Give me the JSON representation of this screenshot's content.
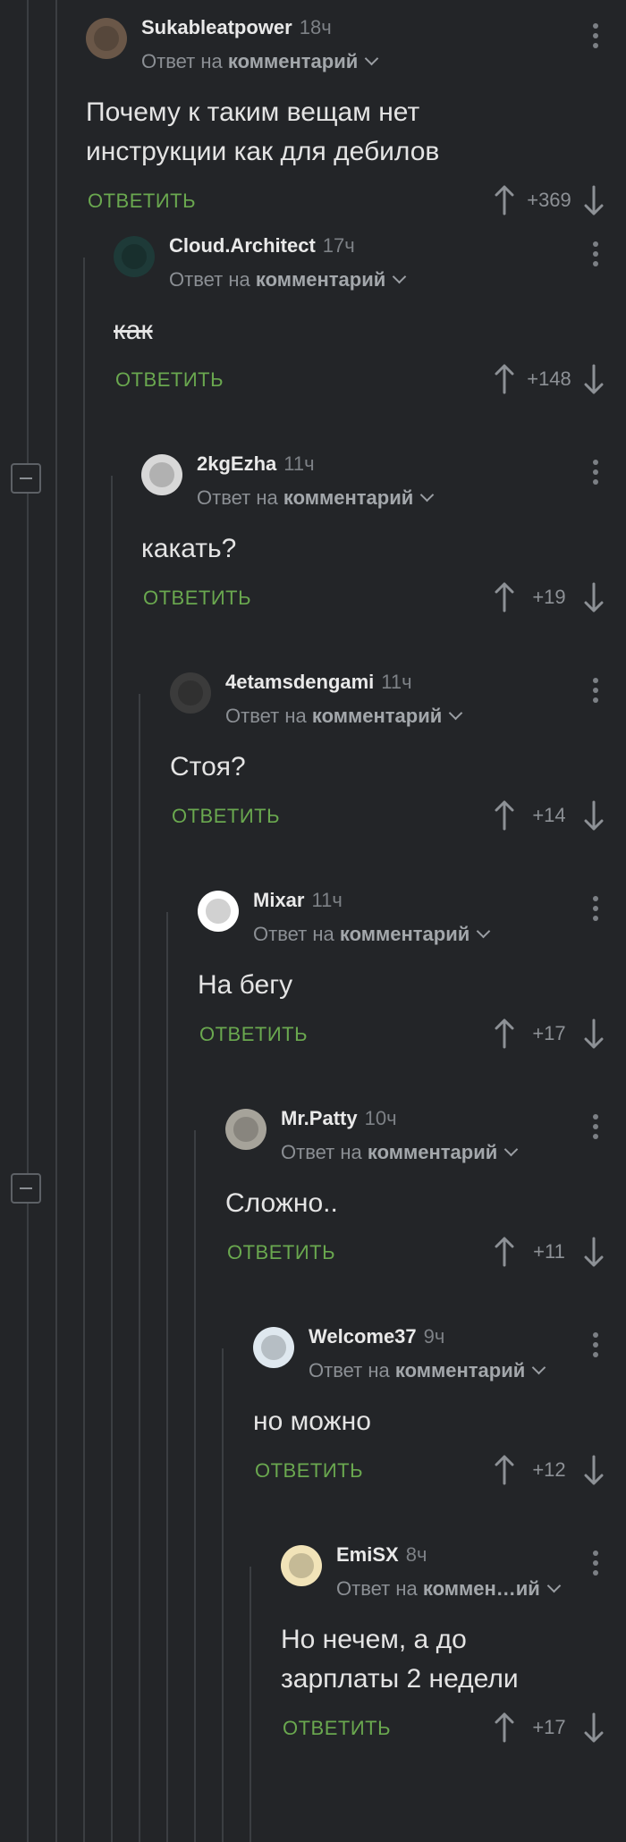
{
  "comments": [
    {
      "user": "Sukableatpower",
      "time": "18ч",
      "reply_prefix": "Ответ на",
      "reply_target": "комментарий",
      "text_lines": [
        "Почему к таким вещам нет",
        "инструкции как для дебилов"
      ],
      "reply_label": "ОТВЕТИТЬ",
      "score": "+369",
      "avatar_color": "#6a5748",
      "strike": false
    },
    {
      "user": "Cloud.Architect",
      "time": "17ч",
      "reply_prefix": "Ответ на",
      "reply_target": "комментарий",
      "text_lines": [
        "как"
      ],
      "reply_label": "ОТВЕТИТЬ",
      "score": "+148",
      "avatar_color": "#1e3a38",
      "strike": true
    },
    {
      "user": "2kgEzha",
      "time": "11ч",
      "reply_prefix": "Ответ на",
      "reply_target": "комментарий",
      "text_lines": [
        "какать?"
      ],
      "reply_label": "ОТВЕТИТЬ",
      "score": "+19",
      "avatar_color": "#d8d8d8",
      "strike": false
    },
    {
      "user": "4etamsdengami",
      "time": "11ч",
      "reply_prefix": "Ответ на",
      "reply_target": "комментарий",
      "text_lines": [
        "Стоя?"
      ],
      "reply_label": "ОТВЕТИТЬ",
      "score": "+14",
      "avatar_color": "#3b3b3b",
      "strike": false
    },
    {
      "user": "Mixar",
      "time": "11ч",
      "reply_prefix": "Ответ на",
      "reply_target": "комментарий",
      "text_lines": [
        "На бегу"
      ],
      "reply_label": "ОТВЕТИТЬ",
      "score": "+17",
      "avatar_color": "#ffffff",
      "strike": false
    },
    {
      "user": "Mr.Patty",
      "time": "10ч",
      "reply_prefix": "Ответ на",
      "reply_target": "комментарий",
      "text_lines": [
        "Сложно.."
      ],
      "reply_label": "ОТВЕТИТЬ",
      "score": "+11",
      "avatar_color": "#a6a39a",
      "strike": false
    },
    {
      "user": "Welcome37",
      "time": "9ч",
      "reply_prefix": "Ответ на",
      "reply_target": "комментарий",
      "text_lines": [
        "но можно"
      ],
      "reply_label": "ОТВЕТИТЬ",
      "score": "+12",
      "avatar_color": "#dfe8ef",
      "strike": false
    },
    {
      "user": "EmiSX",
      "time": "8ч",
      "reply_prefix": "Ответ на",
      "reply_target": "коммен…ий",
      "text_lines": [
        "Но нечем, а до",
        "зарплаты 2 недели"
      ],
      "reply_label": "ОТВЕТИТЬ",
      "score": "+17",
      "avatar_color": "#f1e3b8",
      "strike": false
    }
  ],
  "colors": {
    "background": "#232528",
    "reply_green": "#6aa84f",
    "thread_line": "#3b3e42"
  }
}
